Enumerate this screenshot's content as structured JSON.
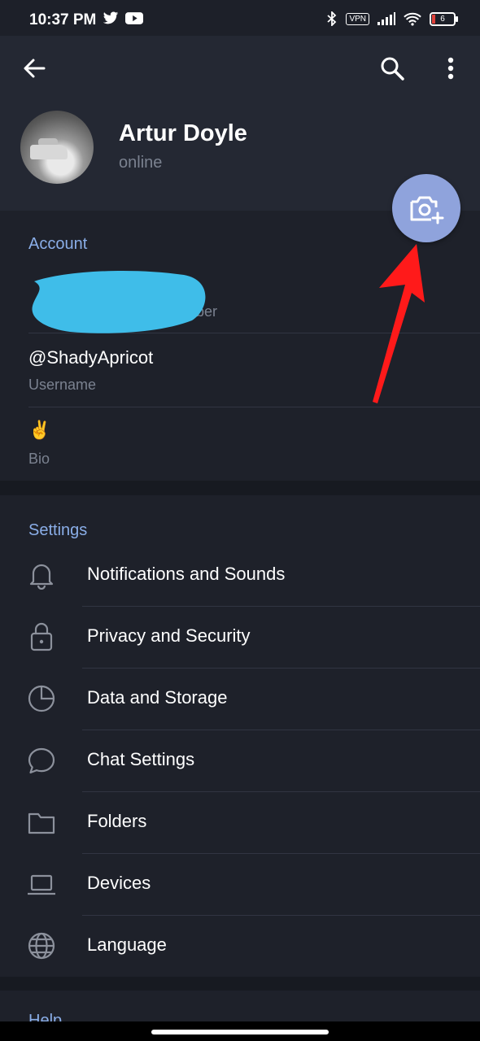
{
  "status_bar": {
    "time": "10:37 PM",
    "vpn": "VPN",
    "battery": "6"
  },
  "header": {
    "name": "Artur Doyle",
    "status": "online"
  },
  "account": {
    "title": "Account",
    "phone": {
      "value": "",
      "label": "mber"
    },
    "username": {
      "value": "@ShadyApricot",
      "label": "Username"
    },
    "bio": {
      "value": "✌️",
      "label": "Bio"
    }
  },
  "settings": {
    "title": "Settings",
    "items": [
      {
        "label": "Notifications and Sounds",
        "icon": "bell-icon"
      },
      {
        "label": "Privacy and Security",
        "icon": "lock-icon"
      },
      {
        "label": "Data and Storage",
        "icon": "pie-chart-icon"
      },
      {
        "label": "Chat Settings",
        "icon": "chat-bubble-icon"
      },
      {
        "label": "Folders",
        "icon": "folder-icon"
      },
      {
        "label": "Devices",
        "icon": "laptop-icon"
      },
      {
        "label": "Language",
        "icon": "globe-icon"
      }
    ]
  },
  "help": {
    "title": "Help"
  },
  "colors": {
    "accent": "#8aaee8",
    "fab": "#8fa3dc",
    "annotation_arrow": "#ff1a1a",
    "redaction": "#3fbde9"
  }
}
